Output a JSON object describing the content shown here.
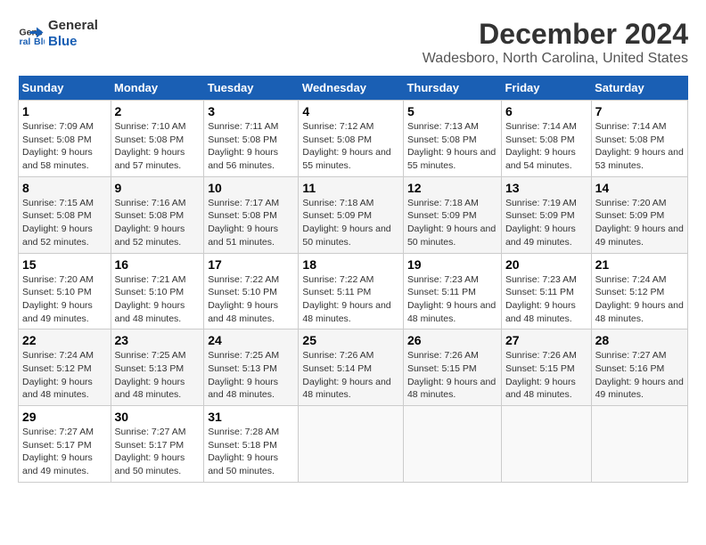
{
  "logo": {
    "line1": "General",
    "line2": "Blue"
  },
  "title": "December 2024",
  "subtitle": "Wadesboro, North Carolina, United States",
  "days_of_week": [
    "Sunday",
    "Monday",
    "Tuesday",
    "Wednesday",
    "Thursday",
    "Friday",
    "Saturday"
  ],
  "weeks": [
    [
      {
        "day": "1",
        "sunrise": "7:09 AM",
        "sunset": "5:08 PM",
        "daylight": "9 hours and 58 minutes."
      },
      {
        "day": "2",
        "sunrise": "7:10 AM",
        "sunset": "5:08 PM",
        "daylight": "9 hours and 57 minutes."
      },
      {
        "day": "3",
        "sunrise": "7:11 AM",
        "sunset": "5:08 PM",
        "daylight": "9 hours and 56 minutes."
      },
      {
        "day": "4",
        "sunrise": "7:12 AM",
        "sunset": "5:08 PM",
        "daylight": "9 hours and 55 minutes."
      },
      {
        "day": "5",
        "sunrise": "7:13 AM",
        "sunset": "5:08 PM",
        "daylight": "9 hours and 55 minutes."
      },
      {
        "day": "6",
        "sunrise": "7:14 AM",
        "sunset": "5:08 PM",
        "daylight": "9 hours and 54 minutes."
      },
      {
        "day": "7",
        "sunrise": "7:14 AM",
        "sunset": "5:08 PM",
        "daylight": "9 hours and 53 minutes."
      }
    ],
    [
      {
        "day": "8",
        "sunrise": "7:15 AM",
        "sunset": "5:08 PM",
        "daylight": "9 hours and 52 minutes."
      },
      {
        "day": "9",
        "sunrise": "7:16 AM",
        "sunset": "5:08 PM",
        "daylight": "9 hours and 52 minutes."
      },
      {
        "day": "10",
        "sunrise": "7:17 AM",
        "sunset": "5:08 PM",
        "daylight": "9 hours and 51 minutes."
      },
      {
        "day": "11",
        "sunrise": "7:18 AM",
        "sunset": "5:09 PM",
        "daylight": "9 hours and 50 minutes."
      },
      {
        "day": "12",
        "sunrise": "7:18 AM",
        "sunset": "5:09 PM",
        "daylight": "9 hours and 50 minutes."
      },
      {
        "day": "13",
        "sunrise": "7:19 AM",
        "sunset": "5:09 PM",
        "daylight": "9 hours and 49 minutes."
      },
      {
        "day": "14",
        "sunrise": "7:20 AM",
        "sunset": "5:09 PM",
        "daylight": "9 hours and 49 minutes."
      }
    ],
    [
      {
        "day": "15",
        "sunrise": "7:20 AM",
        "sunset": "5:10 PM",
        "daylight": "9 hours and 49 minutes."
      },
      {
        "day": "16",
        "sunrise": "7:21 AM",
        "sunset": "5:10 PM",
        "daylight": "9 hours and 48 minutes."
      },
      {
        "day": "17",
        "sunrise": "7:22 AM",
        "sunset": "5:10 PM",
        "daylight": "9 hours and 48 minutes."
      },
      {
        "day": "18",
        "sunrise": "7:22 AM",
        "sunset": "5:11 PM",
        "daylight": "9 hours and 48 minutes."
      },
      {
        "day": "19",
        "sunrise": "7:23 AM",
        "sunset": "5:11 PM",
        "daylight": "9 hours and 48 minutes."
      },
      {
        "day": "20",
        "sunrise": "7:23 AM",
        "sunset": "5:11 PM",
        "daylight": "9 hours and 48 minutes."
      },
      {
        "day": "21",
        "sunrise": "7:24 AM",
        "sunset": "5:12 PM",
        "daylight": "9 hours and 48 minutes."
      }
    ],
    [
      {
        "day": "22",
        "sunrise": "7:24 AM",
        "sunset": "5:12 PM",
        "daylight": "9 hours and 48 minutes."
      },
      {
        "day": "23",
        "sunrise": "7:25 AM",
        "sunset": "5:13 PM",
        "daylight": "9 hours and 48 minutes."
      },
      {
        "day": "24",
        "sunrise": "7:25 AM",
        "sunset": "5:13 PM",
        "daylight": "9 hours and 48 minutes."
      },
      {
        "day": "25",
        "sunrise": "7:26 AM",
        "sunset": "5:14 PM",
        "daylight": "9 hours and 48 minutes."
      },
      {
        "day": "26",
        "sunrise": "7:26 AM",
        "sunset": "5:15 PM",
        "daylight": "9 hours and 48 minutes."
      },
      {
        "day": "27",
        "sunrise": "7:26 AM",
        "sunset": "5:15 PM",
        "daylight": "9 hours and 48 minutes."
      },
      {
        "day": "28",
        "sunrise": "7:27 AM",
        "sunset": "5:16 PM",
        "daylight": "9 hours and 49 minutes."
      }
    ],
    [
      {
        "day": "29",
        "sunrise": "7:27 AM",
        "sunset": "5:17 PM",
        "daylight": "9 hours and 49 minutes."
      },
      {
        "day": "30",
        "sunrise": "7:27 AM",
        "sunset": "5:17 PM",
        "daylight": "9 hours and 50 minutes."
      },
      {
        "day": "31",
        "sunrise": "7:28 AM",
        "sunset": "5:18 PM",
        "daylight": "9 hours and 50 minutes."
      },
      null,
      null,
      null,
      null
    ]
  ],
  "labels": {
    "sunrise": "Sunrise:",
    "sunset": "Sunset:",
    "daylight": "Daylight:"
  }
}
